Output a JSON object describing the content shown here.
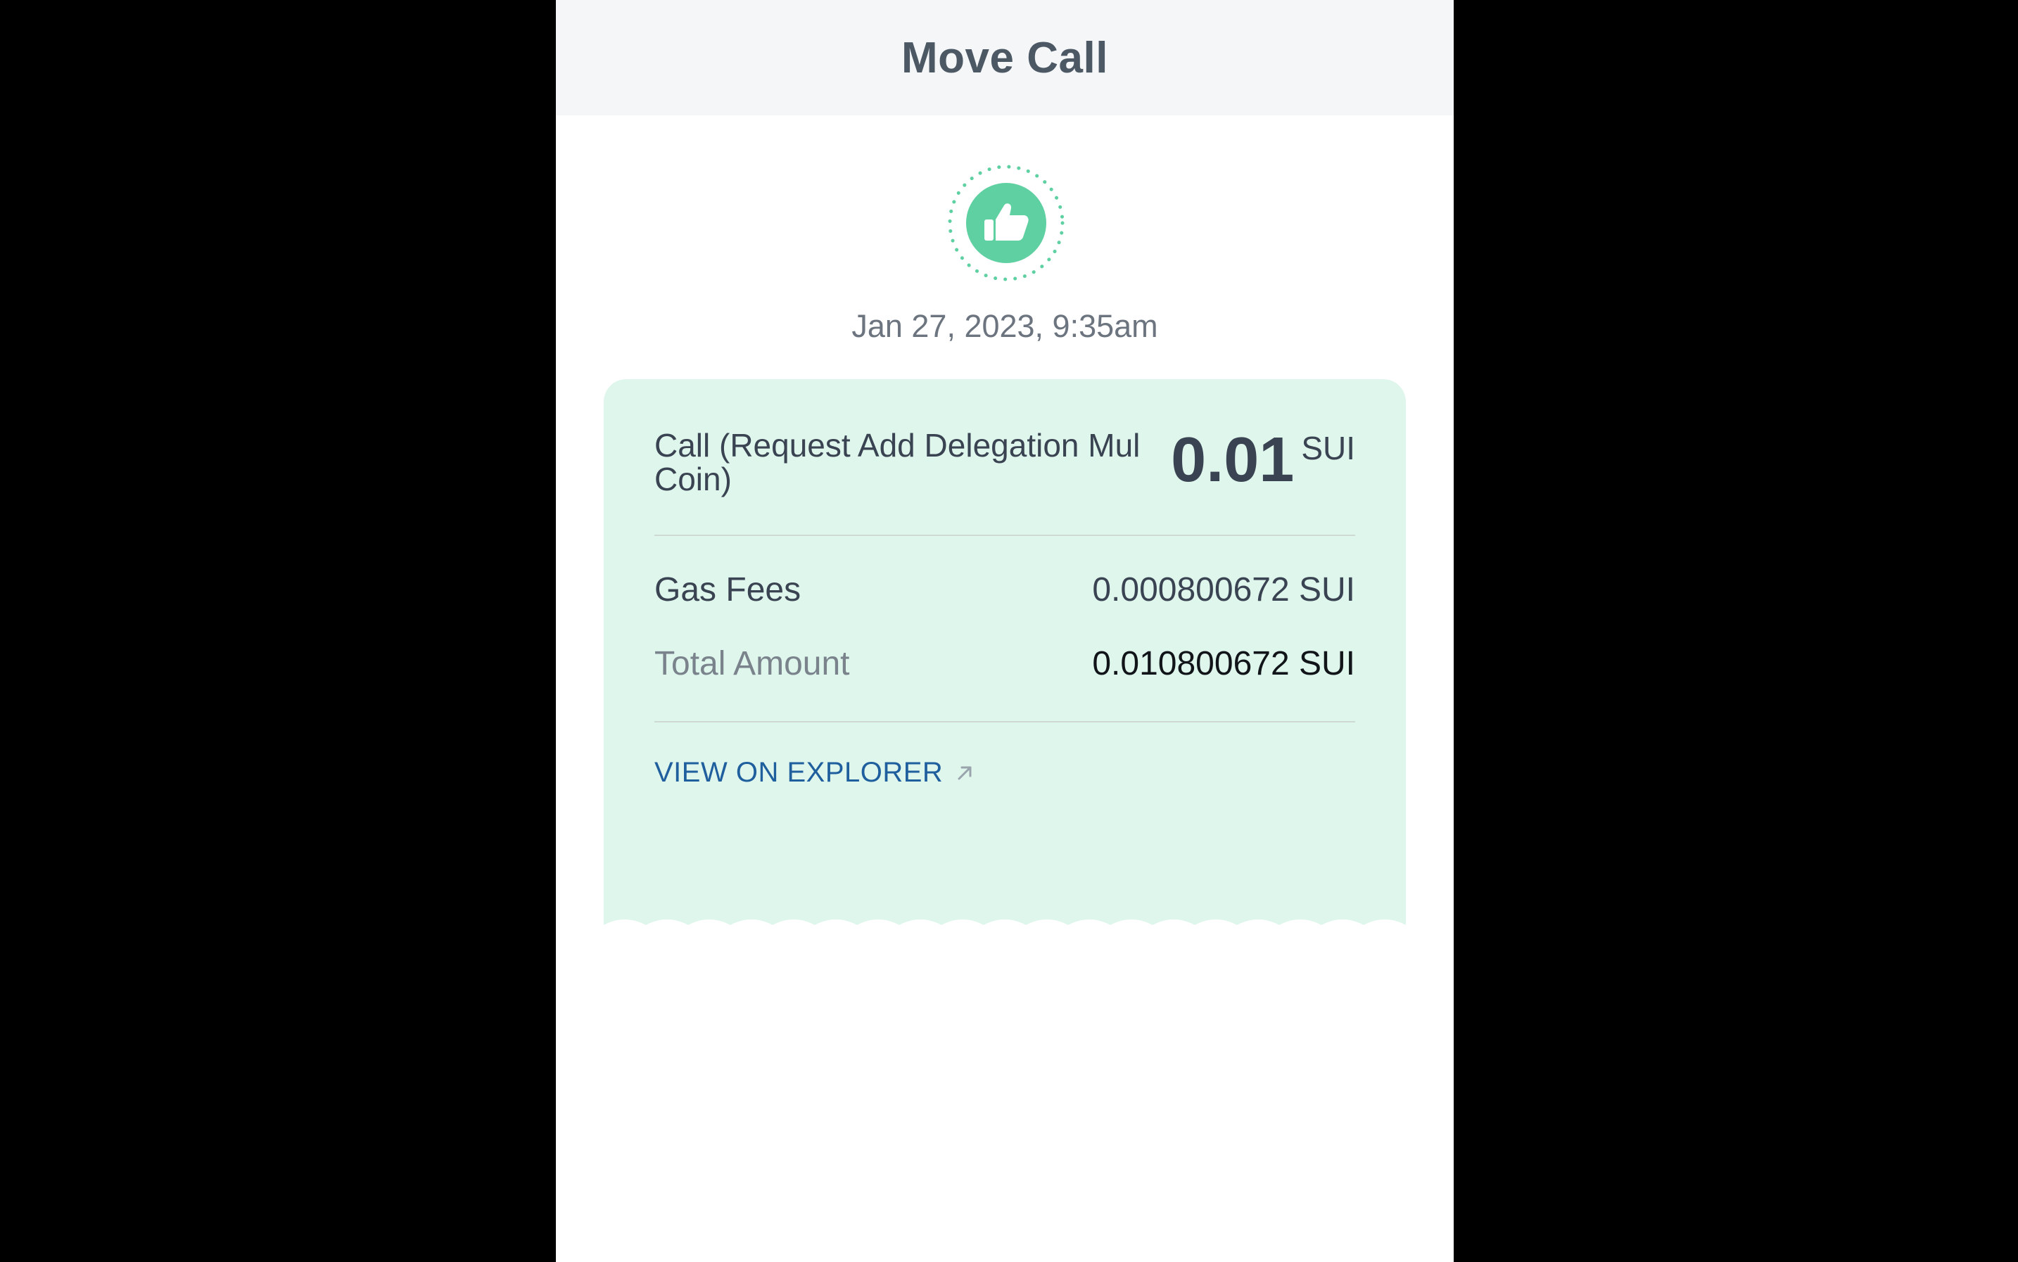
{
  "header": {
    "title": "Move Call"
  },
  "status": {
    "icon": "thumbs-up-icon",
    "accent": "#5fd0a2"
  },
  "timestamp": "Jan 27, 2023, 9:35am",
  "receipt": {
    "call_label": "Call (Request Add Delegation Mul Coin)",
    "amount": "0.01",
    "amount_unit": "SUI",
    "gas_fees_label": "Gas Fees",
    "gas_fees_value": "0.000800672 SUI",
    "total_label": "Total Amount",
    "total_value": "0.010800672 SUI",
    "explorer_link": "VIEW ON EXPLORER",
    "background": "#dff6ec"
  }
}
